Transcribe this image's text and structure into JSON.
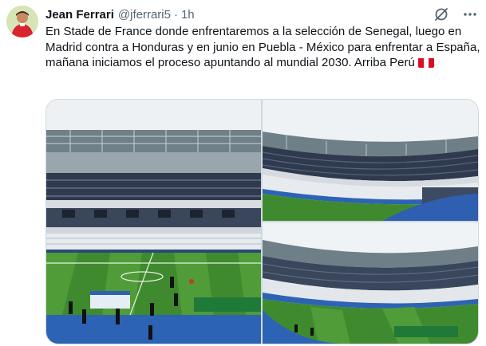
{
  "post": {
    "author_name": "Jean Ferrari",
    "author_handle": "@jferrari5",
    "separator": "·",
    "time": "1h",
    "text": "En Stade de France donde enfrentaremos a la selección de Senegal, luego en Madrid contra a Honduras y en junio en Puebla - México para enfrentar a España, mañana iniciamos el proceso apuntando al mundial 2030. Arriba Perú",
    "flag_icon": "peru-flag-icon",
    "header_icons": [
      "grok-icon",
      "more-icon"
    ]
  },
  "media": {
    "photos": [
      "stadium-photo-wide",
      "stadium-photo-stands",
      "stadium-photo-pitch"
    ]
  },
  "colors": {
    "text": "#0f1419",
    "secondary": "#536471",
    "border": "#cfd9de",
    "pitch": "#3f8a2e",
    "sky": "#dfe5ea",
    "seats": "#2f3a4e"
  }
}
